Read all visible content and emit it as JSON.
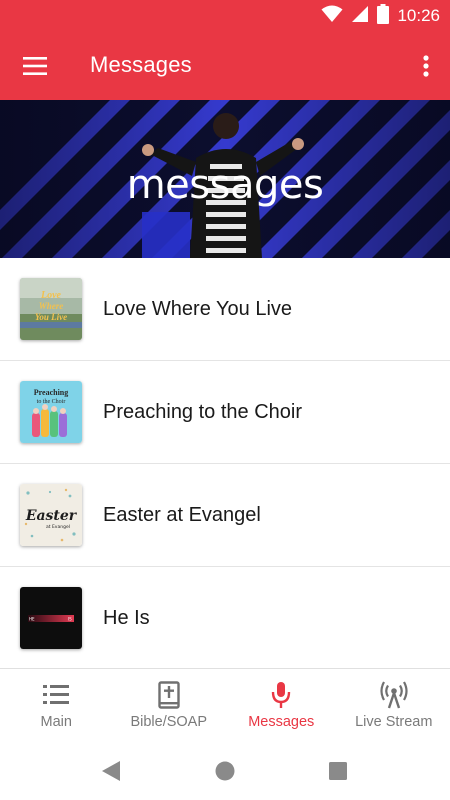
{
  "status_bar": {
    "time": "10:26",
    "icons": [
      "wifi-icon",
      "cell-signal-icon",
      "battery-icon"
    ]
  },
  "app_bar": {
    "title": "Messages",
    "icons": [
      "menu-icon",
      "more-vert-icon"
    ]
  },
  "hero": {
    "text": "messages"
  },
  "messages": [
    {
      "title": "Love Where You Live",
      "thumb_text": [
        "Love",
        "Where",
        "You Live"
      ]
    },
    {
      "title": "Preaching to the Choir",
      "thumb_text": [
        "Preaching",
        "to the Choir"
      ]
    },
    {
      "title": "Easter at Evangel",
      "thumb_text": [
        "Easter",
        "at Evangel"
      ]
    },
    {
      "title": "He Is",
      "thumb_text": [
        "HE",
        "IS"
      ]
    }
  ],
  "bottom_nav": {
    "items": [
      {
        "label": "Main",
        "icon": "list-icon",
        "active": false
      },
      {
        "label": "Bible/SOAP",
        "icon": "bible-icon",
        "active": false
      },
      {
        "label": "Messages",
        "icon": "microphone-icon",
        "active": true
      },
      {
        "label": "Live Stream",
        "icon": "broadcast-icon",
        "active": false
      }
    ]
  },
  "colors": {
    "primary": "#e93744",
    "inactive": "#7a7a7a",
    "hero_bg": "#0c0e2e",
    "hero_stripes": "#3a3fe0"
  }
}
